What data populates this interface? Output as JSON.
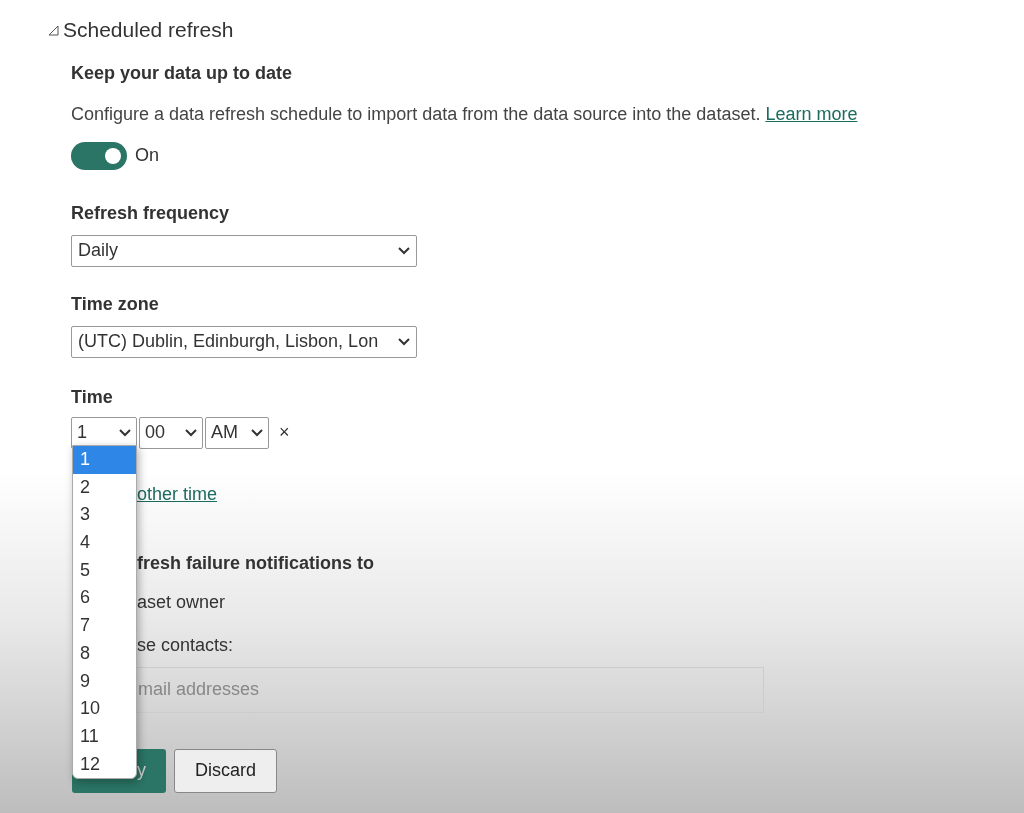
{
  "section": {
    "title": "Scheduled refresh",
    "expanded": true
  },
  "heading": "Keep your data up to date",
  "description": "Configure a data refresh schedule to import data from the data source into the dataset.",
  "learn_more": "Learn more",
  "toggle": {
    "on": true,
    "label": "On"
  },
  "frequency": {
    "label": "Refresh frequency",
    "value": "Daily"
  },
  "time_zone": {
    "label": "Time zone",
    "value": "(UTC) Dublin, Edinburgh, Lisbon, Lon"
  },
  "time": {
    "label": "Time",
    "hour": "1",
    "minute": "00",
    "period": "AM",
    "remove": "×"
  },
  "hour_options": [
    {
      "label": "1",
      "selected": true
    },
    {
      "label": "2",
      "selected": false
    },
    {
      "label": "3",
      "selected": false
    },
    {
      "label": "4",
      "selected": false
    },
    {
      "label": "5",
      "selected": false
    },
    {
      "label": "6",
      "selected": false
    },
    {
      "label": "7",
      "selected": false
    },
    {
      "label": "8",
      "selected": false
    },
    {
      "label": "9",
      "selected": false
    },
    {
      "label": "10",
      "selected": false
    },
    {
      "label": "11",
      "selected": false
    },
    {
      "label": "12",
      "selected": false
    }
  ],
  "add_time": "other time",
  "notifications_heading": "fresh failure notifications to",
  "owner_option": "aset owner",
  "contacts_option": "se contacts:",
  "email": {
    "placeholder": "mail addresses"
  },
  "buttons": [
    {
      "kind": "primary",
      "label": "y"
    },
    {
      "kind": "secondary",
      "label": "Discard"
    }
  ]
}
